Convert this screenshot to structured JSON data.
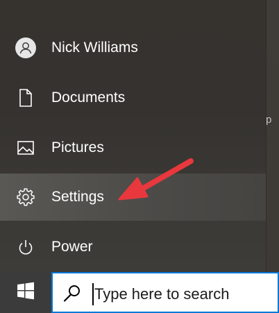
{
  "start_menu": {
    "items": [
      {
        "label": "Nick Williams",
        "icon": "user-avatar-icon"
      },
      {
        "label": "Documents",
        "icon": "document-icon"
      },
      {
        "label": "Pictures",
        "icon": "pictures-icon"
      },
      {
        "label": "Settings",
        "icon": "gear-icon",
        "highlighted": true
      },
      {
        "label": "Power",
        "icon": "power-icon"
      }
    ]
  },
  "background": {
    "partial_text": "p A"
  },
  "annotation": {
    "arrow_color": "#e8383d",
    "points_to": "Settings"
  },
  "taskbar": {
    "start_icon": "windows-logo-icon",
    "search": {
      "icon": "search-icon",
      "placeholder": "Type here to search"
    }
  },
  "colors": {
    "accent": "#0078d7",
    "menu_background": "#36332f",
    "taskbar_background": "#2b2b2b"
  }
}
